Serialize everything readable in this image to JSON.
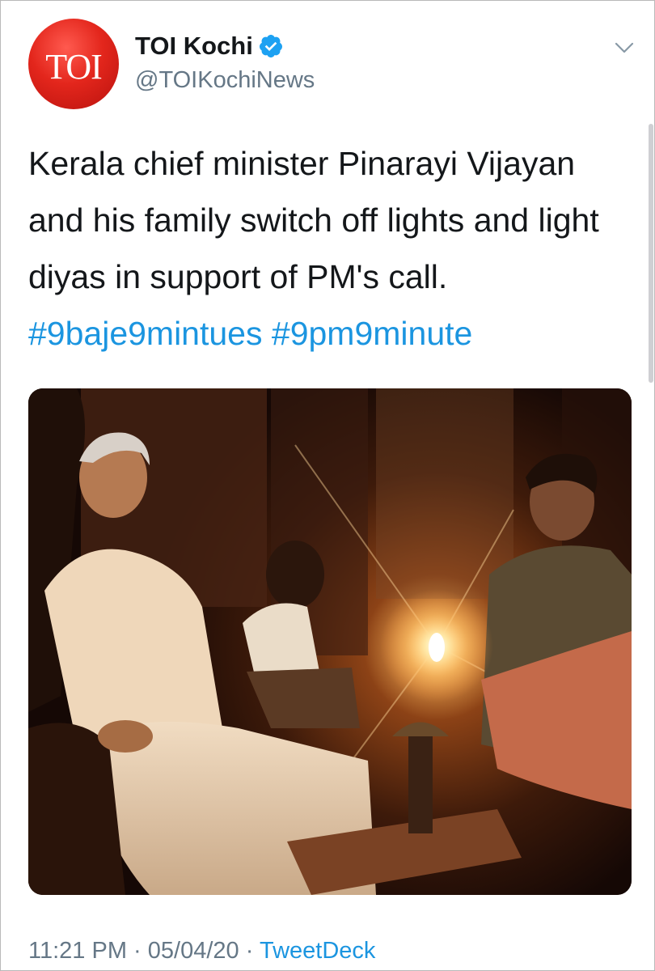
{
  "account": {
    "avatar_text": "TOI",
    "display_name": "TOI Kochi",
    "handle": "@TOIKochiNews",
    "verified": true
  },
  "tweet": {
    "text": "Kerala chief minister Pinarayi Vijayan and his family switch off lights and light diyas in support of PM's call.",
    "hashtags": [
      "#9baje9mintues",
      "#9pm9minute"
    ]
  },
  "media": {
    "description": "photo"
  },
  "meta": {
    "time": "11:21 PM",
    "separator": "·",
    "date": "05/04/20",
    "source": "TweetDeck"
  },
  "colors": {
    "link": "#1b95e0",
    "secondary_text": "#657786",
    "brand_red": "#e3261c",
    "verified_blue": "#1da1f2"
  },
  "icons": {
    "verified": "verified-badge-icon",
    "caret": "chevron-down-icon"
  }
}
